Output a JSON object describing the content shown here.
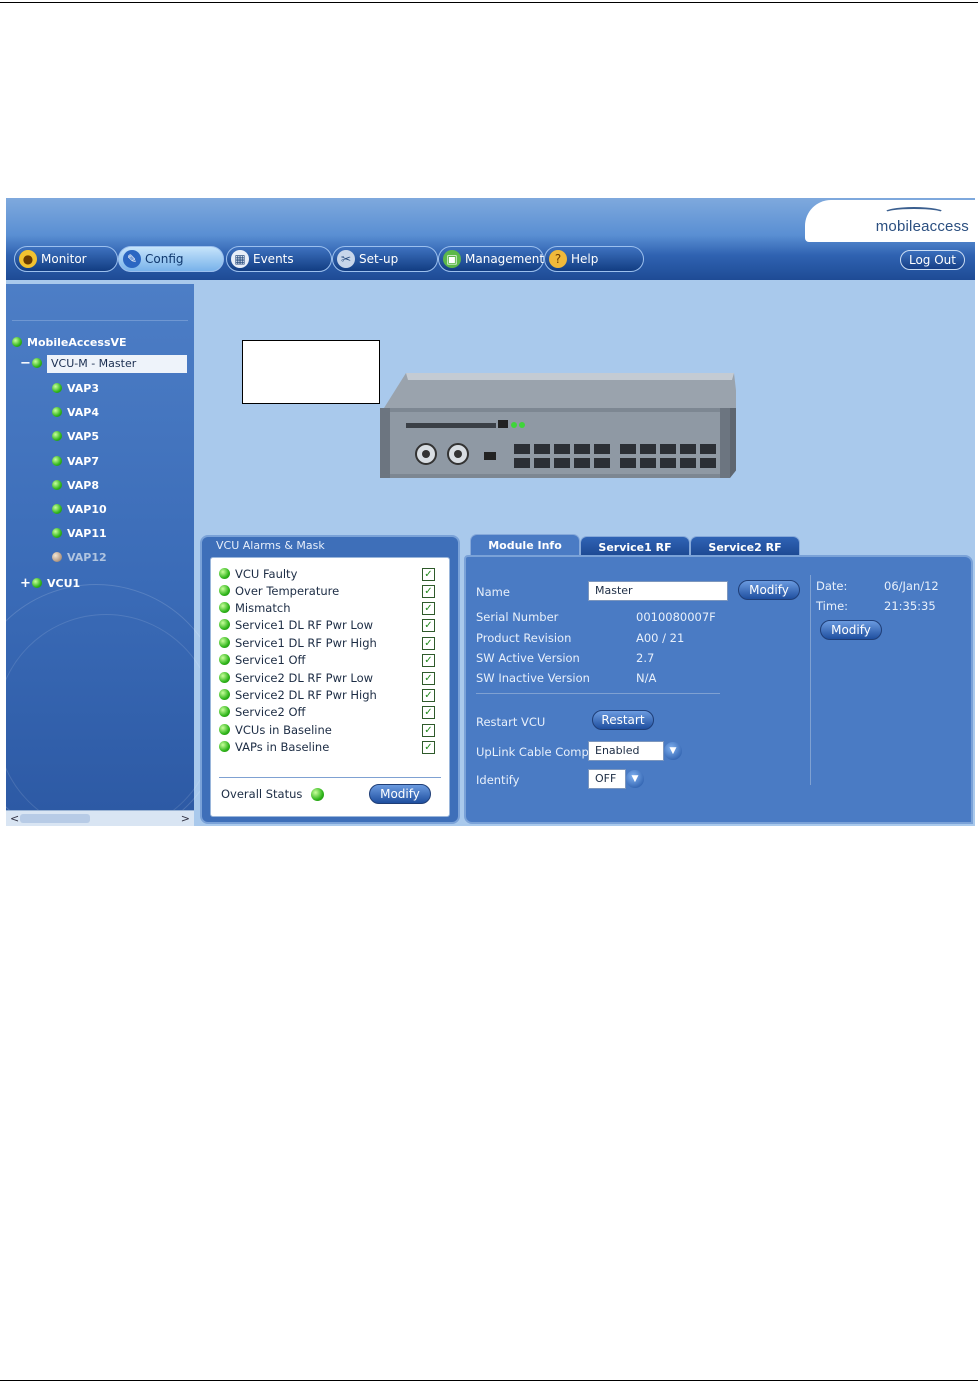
{
  "brand": {
    "logo_text": "mobileaccess"
  },
  "nav": {
    "tabs": [
      {
        "label": "Monitor",
        "icon": "monitor-icon"
      },
      {
        "label": "Config",
        "icon": "wrench-icon"
      },
      {
        "label": "Events",
        "icon": "events-icon"
      },
      {
        "label": "Set-up",
        "icon": "setup-icon"
      },
      {
        "label": "Management",
        "icon": "management-icon"
      },
      {
        "label": "Help",
        "icon": "help-icon"
      }
    ],
    "active_tab": "Config",
    "logout_label": "Log Out"
  },
  "tree": {
    "root": "MobileAccessVE",
    "selected": "VCU-M - Master",
    "children": [
      "VAP3",
      "VAP4",
      "VAP5",
      "VAP7",
      "VAP8",
      "VAP10",
      "VAP11",
      "VAP12"
    ],
    "other": "VCU1",
    "status_colors": {
      "ok": "#2fb51a",
      "inactive": "#b9a08a"
    }
  },
  "alarms": {
    "title": "VCU Alarms & Mask",
    "items": [
      "VCU Faulty",
      "Over Temperature",
      "Mismatch",
      "Service1 DL RF Pwr Low",
      "Service1 DL RF Pwr High",
      "Service1 Off",
      "Service2 DL RF Pwr Low",
      "Service2 DL RF Pwr High",
      "Service2 Off",
      "VCUs in Baseline",
      "VAPs in Baseline"
    ],
    "overall_label": "Overall Status",
    "modify_label": "Modify"
  },
  "module": {
    "tabs": [
      "Module Info",
      "Service1 RF",
      "Service2 RF"
    ],
    "name_label": "Name",
    "name_value": "Master",
    "modify_label": "Modify",
    "serial_label": "Serial Number",
    "serial_value": "0010080007F",
    "product_label": "Product Revision",
    "product_value": "A00 / 21",
    "sw_active_label": "SW Active Version",
    "sw_active_value": "2.7",
    "sw_inactive_label": "SW Inactive Version",
    "sw_inactive_value": "N/A",
    "restart_label": "Restart VCU",
    "restart_button": "Restart",
    "uplink_label": "UpLink Cable Comp.",
    "uplink_value": "Enabled",
    "identify_label": "Identify",
    "identify_value": "OFF",
    "date_label": "Date:",
    "date_value": "06/Jan/12",
    "time_label": "Time:",
    "time_value": "21:35:35",
    "datetime_modify": "Modify"
  }
}
